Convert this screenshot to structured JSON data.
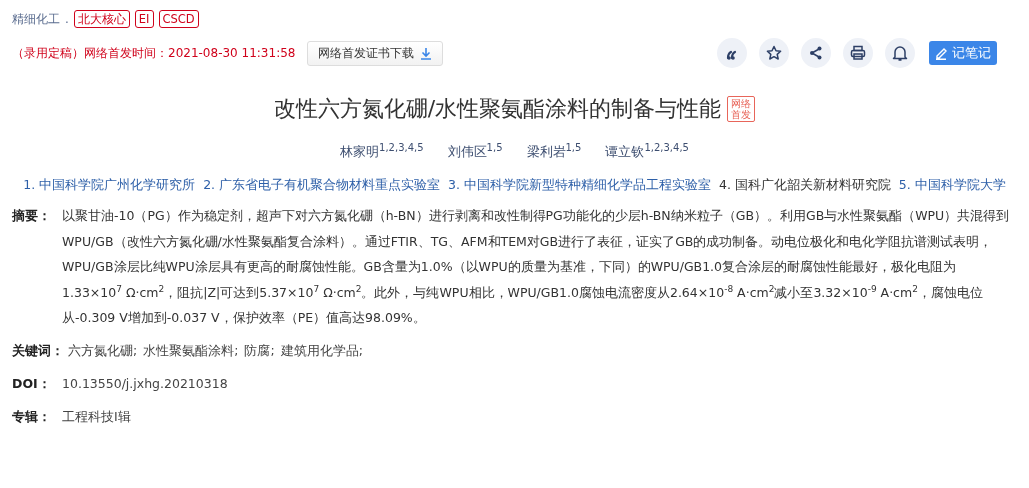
{
  "journal": "精细化工",
  "journal_sep": ".",
  "tags": [
    "北大核心",
    "EI",
    "CSCD"
  ],
  "publish_time": "（录用定稿）网络首发时间：2021-08-30 11:31:58",
  "cert_button": "网络首发证书下载",
  "actions": [
    {
      "kind": "quote"
    },
    {
      "kind": "favorite"
    },
    {
      "kind": "share"
    },
    {
      "kind": "print"
    },
    {
      "kind": "alert"
    }
  ],
  "note_button": "记笔记",
  "title": "改性六方氮化硼/水性聚氨酯涂料的制备与性能",
  "title_badge": "网络首发",
  "authors": [
    {
      "name": "林家明",
      "affil": "1,2,3,4,5"
    },
    {
      "name": "刘伟区",
      "affil": "1,5"
    },
    {
      "name": "梁利岩",
      "affil": "1,5"
    },
    {
      "name": "谭立钦",
      "affil": "1,2,3,4,5"
    }
  ],
  "affiliations": [
    {
      "text": "1. 中国科学院广州化学研究所",
      "linked": true
    },
    {
      "text": "2. 广东省电子有机聚合物材料重点实验室",
      "linked": true
    },
    {
      "text": "3. 中国科学院新型特种精细化学品工程实验室",
      "linked": true
    },
    {
      "text": "4. 国科广化韶关新材料研究院",
      "linked": false
    },
    {
      "text": "5. 中国科学院大学",
      "linked": true
    }
  ],
  "abstract": {
    "label": "摘要：",
    "text": "以聚甘油-10（PG）作为稳定剂，超声下对六方氮化硼（h-BN）进行剥离和改性制得PG功能化的少层h-BN纳米粒子（GB）。利用GB与水性聚氨酯（WPU）共混得到WPU/GB（改性六方氮化硼/水性聚氨酯复合涂料）。通过FTIR、TG、AFM和TEM对GB进行了表征，证实了GB的成功制备。动电位极化和电化学阻抗谱测试表明，WPU/GB涂层比纯WPU涂层具有更高的耐腐蚀性能。GB含量为1.0%（以WPU的质量为基准，下同）的WPU/GB1.0复合涂层的耐腐蚀性能最好，极化电阻为1.33×10$^{7}$ Ω·cm$^{2}$，阻抗|Z|可达到5.37×10$^{7}$ Ω·cm$^{2}$。此外，与纯WPU相比，WPU/GB1.0腐蚀电流密度从2.64×10$^{-8}$ A·cm$^{2}$减小至3.32×10$^{-9}$ A·cm$^{2}$，腐蚀电位从-0.309 V增加到-0.037 V，保护效率（PE）值高达98.09%。"
  },
  "keywords": {
    "label": "关键词：",
    "items": [
      "六方氮化硼;",
      "水性聚氨酯涂料;",
      "防腐;",
      "建筑用化学品;"
    ]
  },
  "doi": {
    "label": "DOI：",
    "value": "10.13550/j.jxhg.20210318"
  },
  "album": {
    "label": "专辑：",
    "value": "工程科技Ⅰ辑"
  }
}
